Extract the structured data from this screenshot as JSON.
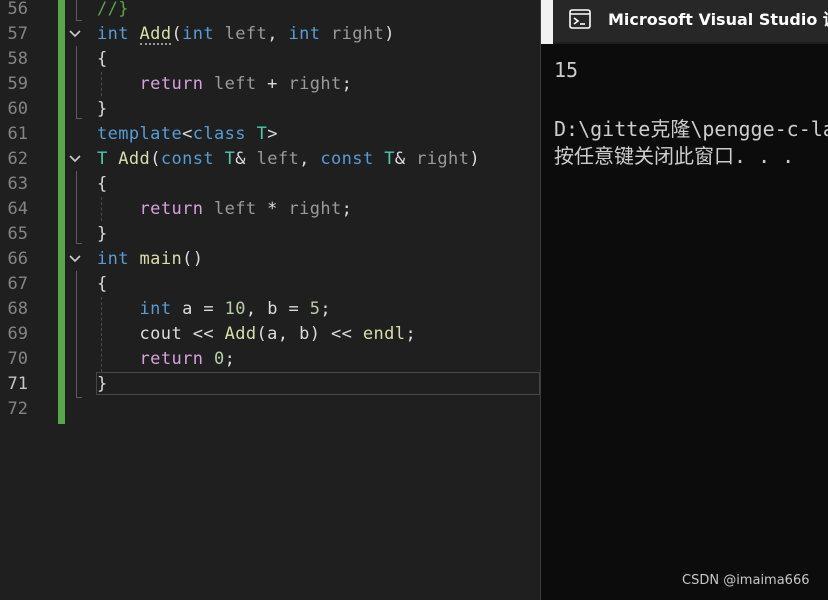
{
  "editor": {
    "active_line": "71",
    "lines": [
      {
        "num": "56",
        "tokens": [
          {
            "t": "//}",
            "c": "cm"
          }
        ]
      },
      {
        "num": "57",
        "tokens": [
          {
            "t": "int",
            "c": "kw"
          },
          {
            "t": " "
          },
          {
            "t": "Add",
            "c": "fn dots"
          },
          {
            "t": "("
          },
          {
            "t": "int",
            "c": "kw"
          },
          {
            "t": " "
          },
          {
            "t": "left",
            "c": "pm"
          },
          {
            "t": ", "
          },
          {
            "t": "int",
            "c": "kw"
          },
          {
            "t": " "
          },
          {
            "t": "right",
            "c": "pm"
          },
          {
            "t": ")"
          }
        ]
      },
      {
        "num": "58",
        "tokens": [
          {
            "t": "{"
          }
        ]
      },
      {
        "num": "59",
        "tokens": [
          {
            "t": "    "
          },
          {
            "t": "return",
            "c": "ctl"
          },
          {
            "t": " "
          },
          {
            "t": "left",
            "c": "pm"
          },
          {
            "t": " + "
          },
          {
            "t": "right",
            "c": "pm"
          },
          {
            "t": ";"
          }
        ]
      },
      {
        "num": "60",
        "tokens": [
          {
            "t": "}"
          }
        ]
      },
      {
        "num": "61",
        "tokens": [
          {
            "t": "template",
            "c": "kw"
          },
          {
            "t": "<"
          },
          {
            "t": "class",
            "c": "kw"
          },
          {
            "t": " "
          },
          {
            "t": "T",
            "c": "ty"
          },
          {
            "t": ">"
          }
        ]
      },
      {
        "num": "62",
        "tokens": [
          {
            "t": "T",
            "c": "ty"
          },
          {
            "t": " "
          },
          {
            "t": "Add",
            "c": "fn"
          },
          {
            "t": "("
          },
          {
            "t": "const",
            "c": "kw"
          },
          {
            "t": " "
          },
          {
            "t": "T",
            "c": "ty"
          },
          {
            "t": "& "
          },
          {
            "t": "left",
            "c": "pm"
          },
          {
            "t": ", "
          },
          {
            "t": "const",
            "c": "kw"
          },
          {
            "t": " "
          },
          {
            "t": "T",
            "c": "ty"
          },
          {
            "t": "& "
          },
          {
            "t": "right",
            "c": "pm"
          },
          {
            "t": ")"
          }
        ]
      },
      {
        "num": "63",
        "tokens": [
          {
            "t": "{"
          }
        ]
      },
      {
        "num": "64",
        "tokens": [
          {
            "t": "    "
          },
          {
            "t": "return",
            "c": "ctl"
          },
          {
            "t": " "
          },
          {
            "t": "left",
            "c": "pm"
          },
          {
            "t": " * "
          },
          {
            "t": "right",
            "c": "pm"
          },
          {
            "t": ";"
          }
        ]
      },
      {
        "num": "65",
        "tokens": [
          {
            "t": "}"
          }
        ]
      },
      {
        "num": "66",
        "tokens": [
          {
            "t": "int",
            "c": "kw"
          },
          {
            "t": " "
          },
          {
            "t": "main",
            "c": "fn"
          },
          {
            "t": "()"
          }
        ]
      },
      {
        "num": "67",
        "tokens": [
          {
            "t": "{"
          }
        ]
      },
      {
        "num": "68",
        "tokens": [
          {
            "t": "    "
          },
          {
            "t": "int",
            "c": "kw"
          },
          {
            "t": " a = "
          },
          {
            "t": "10",
            "c": "num"
          },
          {
            "t": ", b = "
          },
          {
            "t": "5",
            "c": "num"
          },
          {
            "t": ";"
          }
        ]
      },
      {
        "num": "69",
        "tokens": [
          {
            "t": "    cout << "
          },
          {
            "t": "Add",
            "c": "fn"
          },
          {
            "t": "(a, b) << "
          },
          {
            "t": "endl",
            "c": "fn"
          },
          {
            "t": ";"
          }
        ]
      },
      {
        "num": "70",
        "tokens": [
          {
            "t": "    "
          },
          {
            "t": "return",
            "c": "ctl"
          },
          {
            "t": " "
          },
          {
            "t": "0",
            "c": "num"
          },
          {
            "t": ";"
          }
        ]
      },
      {
        "num": "71",
        "tokens": [
          {
            "t": "}"
          }
        ]
      },
      {
        "num": "72",
        "tokens": []
      }
    ],
    "fold_lines": [
      "57",
      "62",
      "66"
    ]
  },
  "console": {
    "title": "Microsoft Visual Studio 调试控制台",
    "icon": "console-window-icon",
    "output": [
      "15",
      "",
      "D:\\gitte克隆\\pengge-c-language-c",
      "按任意键关闭此窗口. . ."
    ]
  },
  "watermark": "CSDN @imaima666",
  "colors": {
    "editor_bg": "#1f1f1f",
    "console_bg": "#0c0c0c",
    "keyword": "#569cd6",
    "control": "#d8a0df",
    "function": "#dcdcaa",
    "type": "#4ec9b0",
    "number": "#b5cea8",
    "comment": "#57a64a",
    "change_bar": "#57a64a"
  }
}
